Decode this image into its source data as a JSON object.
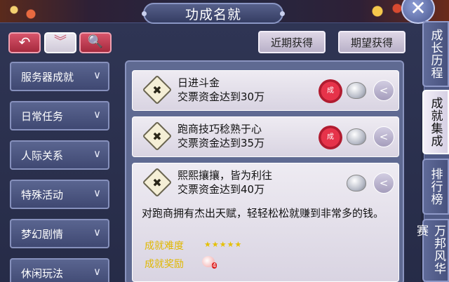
{
  "window": {
    "title": "功成名就",
    "close_glyph": "✕"
  },
  "toolbar": {
    "back_glyph": "↶",
    "fold_glyph": "︾",
    "search_glyph": "🔍"
  },
  "categories": [
    {
      "label": "服务器成就"
    },
    {
      "label": "日常任务"
    },
    {
      "label": "人际关系"
    },
    {
      "label": "特殊活动"
    },
    {
      "label": "梦幻剧情"
    },
    {
      "label": "休闲玩法"
    }
  ],
  "top_buttons": {
    "recent": "近期获得",
    "expected": "期望获得"
  },
  "achievements": [
    {
      "name": "日进斗金",
      "desc": "交票资金达到30万",
      "icon": "medal-icon",
      "stamp": "成"
    },
    {
      "name": "跑商技巧稔熟于心",
      "desc": "交票资金达到35万",
      "icon": "medal-icon",
      "stamp": "成"
    },
    {
      "name": "熙熙攘攘，皆为利往",
      "desc": "交票资金达到40万",
      "icon": "medal-icon"
    }
  ],
  "detail": {
    "text": "对跑商拥有杰出天赋，轻轻松松就赚到非常多的钱。",
    "difficulty_label": "成就难度",
    "difficulty_stars": "★★★★★",
    "reward_label": "成就奖励",
    "reward_count": "4"
  },
  "side_tabs": [
    {
      "label": "成长历程",
      "active": false
    },
    {
      "label": "成就集成",
      "active": true
    },
    {
      "label": "排行榜",
      "active": false
    },
    {
      "label": "万邦风华赛",
      "active": false
    }
  ],
  "colors": {
    "accent_red": "#c8324a",
    "gold_label": "#e0b800",
    "panel": "#2f3554"
  }
}
